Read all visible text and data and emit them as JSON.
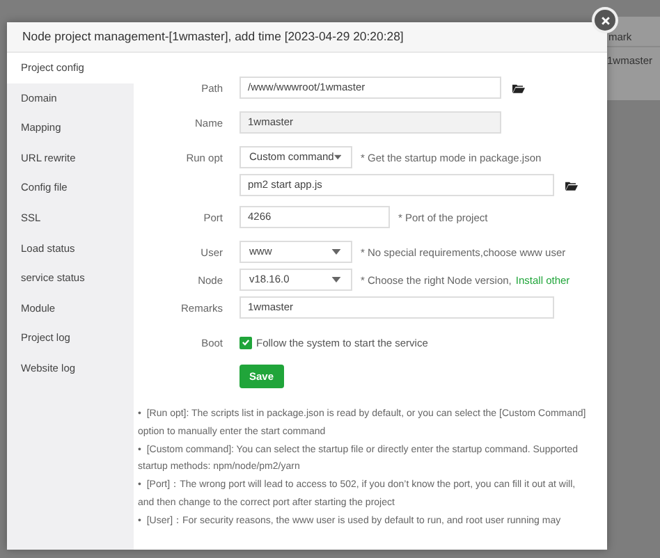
{
  "background_table": {
    "header": "mark",
    "cell": "1wmaster"
  },
  "window": {
    "title": "Node project management-[1wmaster], add time [2023-04-29 20:20:28]"
  },
  "sidebar": {
    "items": [
      {
        "label": "Project config",
        "selected": true
      },
      {
        "label": "Domain",
        "selected": false
      },
      {
        "label": "Mapping",
        "selected": false
      },
      {
        "label": "URL rewrite",
        "selected": false
      },
      {
        "label": "Config file",
        "selected": false
      },
      {
        "label": "SSL",
        "selected": false
      },
      {
        "label": "Load status",
        "selected": false
      },
      {
        "label": "service status",
        "selected": false
      },
      {
        "label": "Module",
        "selected": false
      },
      {
        "label": "Project log",
        "selected": false
      },
      {
        "label": "Website log",
        "selected": false
      }
    ]
  },
  "form": {
    "rows": [
      {
        "kind": "path",
        "label": "Path",
        "value": "/www/wwwroot/1wmaster"
      },
      {
        "kind": "readonly",
        "label": "Name",
        "value": "1wmaster"
      },
      {
        "kind": "select",
        "label": "Run opt",
        "value": "Custom command",
        "hint": "* Get the startup mode in package.json"
      },
      {
        "kind": "command",
        "value": "pm2 start app.js"
      },
      {
        "kind": "port",
        "label": "Port",
        "value": "4266",
        "hint": "* Port of the project"
      },
      {
        "kind": "select",
        "label": "User",
        "value": "www",
        "hint": "* No special requirements,choose www user"
      },
      {
        "kind": "select",
        "label": "Node",
        "value": "v18.16.0",
        "hint": "* Choose the right Node version,",
        "link": "Install other"
      },
      {
        "kind": "remarks",
        "label": "Remarks",
        "value": "1wmaster"
      },
      {
        "kind": "checkbox",
        "label": "Boot",
        "checked": true,
        "text": "Follow the system to start the service"
      }
    ],
    "save_button": "Save"
  },
  "notes": [
    "•  [Run opt]: The scripts list in package.json is read by default, or you can select the [Custom Command] option to manually enter the start command",
    "•  [Custom command]: You can select the startup file or directly enter the startup command. Supported startup methods: npm/node/pm2/yarn",
    "•  [Port]：The wrong port will lead to access to 502, if you don’t know the port, you can fill it out at will, and then change to the correct port after starting the project",
    "•  [User]：For security reasons, the www user is used by default to run, and root user running may"
  ]
}
